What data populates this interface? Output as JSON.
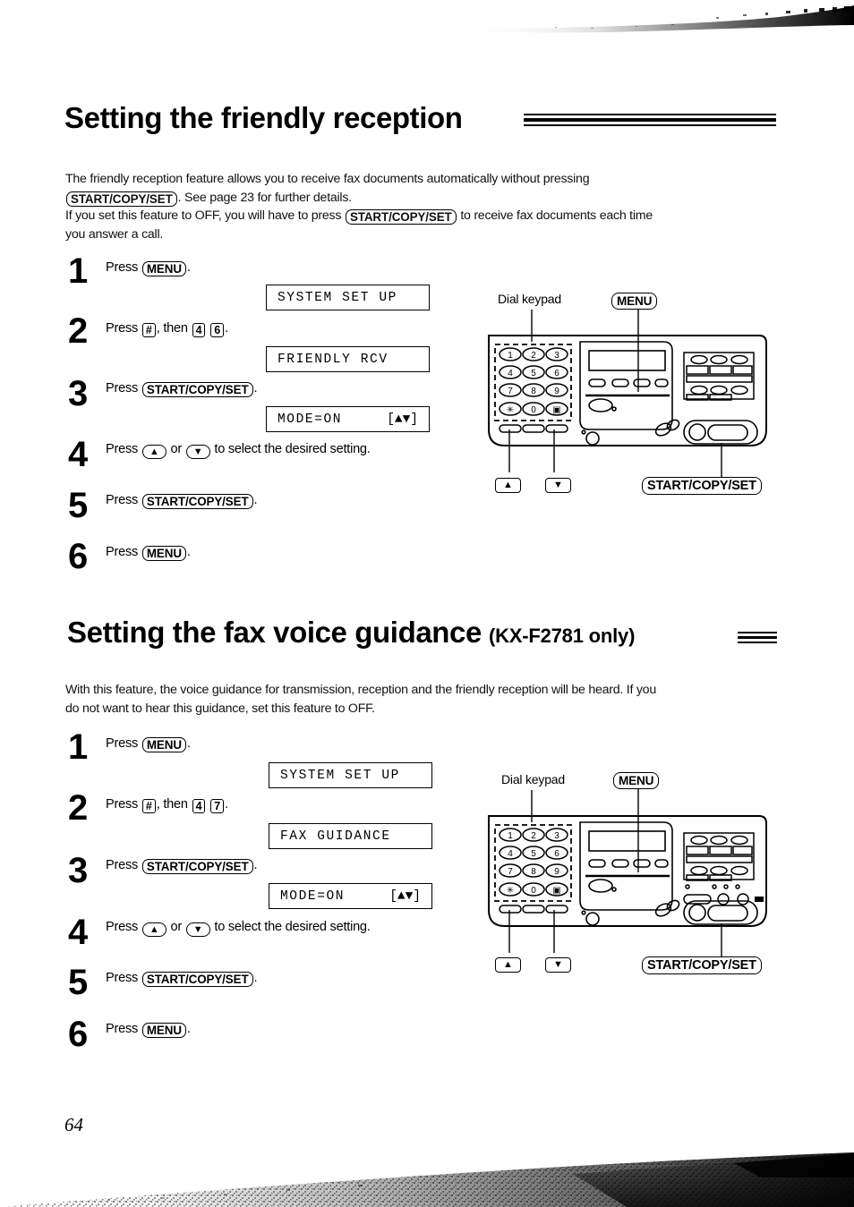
{
  "page": {
    "number": "64"
  },
  "sections": [
    {
      "heading": "Setting the friendly reception",
      "heading_suffix": "",
      "body": [
        "The friendly reception feature allows you to receive fax documents automatically without pressing",
        "START/COPY/SET|. See page 23 for further details.",
        "If you set this feature to OFF, you will have to press |START/COPY/SET| to receive fax documents each time",
        "you answer a call."
      ],
      "body_line1": "The friendly reception feature allows you to receive fax documents automatically without pressing",
      "body_line2_key": "START/COPY/SET",
      "body_line2_rest": ". See page 23 for further details.",
      "body_line3_pre": "If you set this feature to OFF, you will have to press",
      "body_line3_key": "START/COPY/SET",
      "body_line3_post": "to receive fax documents each time",
      "body_line4": "you answer a call.",
      "steps": [
        {
          "num": "1",
          "pre": "Press",
          "key": "MENU",
          "post": "."
        },
        {
          "num": "2",
          "pre": "Press",
          "key": "#",
          "mid": ", then",
          "key2": "4",
          "key3": "6",
          "post": "."
        },
        {
          "num": "3",
          "pre": "Press",
          "key": "START/COPY/SET",
          "post": "."
        },
        {
          "num": "4",
          "pre": "Press",
          "key": "▲",
          "mid": "or",
          "key2": "▼",
          "post": "to select the desired setting."
        },
        {
          "num": "5",
          "pre": "Press",
          "key": "START/COPY/SET",
          "post": "."
        },
        {
          "num": "6",
          "pre": "Press",
          "key": "MENU",
          "post": "."
        }
      ],
      "displays": [
        {
          "left": "SYSTEM SET UP",
          "right": ""
        },
        {
          "left": "FRIENDLY RCV",
          "right": ""
        },
        {
          "left": "MODE=ON",
          "right": "[▲▼]"
        }
      ],
      "diagram": {
        "label_keypad": "Dial keypad",
        "label_menu": "MENU",
        "label_start": "START/COPY/SET",
        "label_up": "▲",
        "label_down": "▼",
        "keypad_keys": [
          "1",
          "2",
          "3",
          "4",
          "5",
          "6",
          "7",
          "8",
          "9",
          "∗",
          "0",
          "▣"
        ]
      }
    },
    {
      "heading": "Setting the fax voice guidance",
      "heading_suffix": "(KX-F2781 only)",
      "body_line1": "With this feature, the voice guidance for transmission, reception and the friendly reception will be heard. If you",
      "body_line2": "do not want to hear this guidance, set this feature to OFF.",
      "steps": [
        {
          "num": "1",
          "pre": "Press",
          "key": "MENU",
          "post": "."
        },
        {
          "num": "2",
          "pre": "Press",
          "key": "#",
          "mid": ", then",
          "key2": "4",
          "key3": "7",
          "post": "."
        },
        {
          "num": "3",
          "pre": "Press",
          "key": "START/COPY/SET",
          "post": "."
        },
        {
          "num": "4",
          "pre": "Press",
          "key": "▲",
          "mid": "or",
          "key2": "▼",
          "post": "to select the desired setting."
        },
        {
          "num": "5",
          "pre": "Press",
          "key": "START/COPY/SET",
          "post": "."
        },
        {
          "num": "6",
          "pre": "Press",
          "key": "MENU",
          "post": "."
        }
      ],
      "displays": [
        {
          "left": "SYSTEM SET UP",
          "right": ""
        },
        {
          "left": "FAX GUIDANCE",
          "right": ""
        },
        {
          "left": "MODE=ON",
          "right": "[▲▼]"
        }
      ],
      "diagram": {
        "label_keypad": "Dial keypad",
        "label_menu": "MENU",
        "label_start": "START/COPY/SET",
        "label_up": "▲",
        "label_down": "▼",
        "keypad_keys": [
          "1",
          "2",
          "3",
          "4",
          "5",
          "6",
          "7",
          "8",
          "9",
          "∗",
          "0",
          "▣"
        ]
      }
    }
  ],
  "colors": {
    "ink": "#000000",
    "paper": "#ffffff"
  }
}
